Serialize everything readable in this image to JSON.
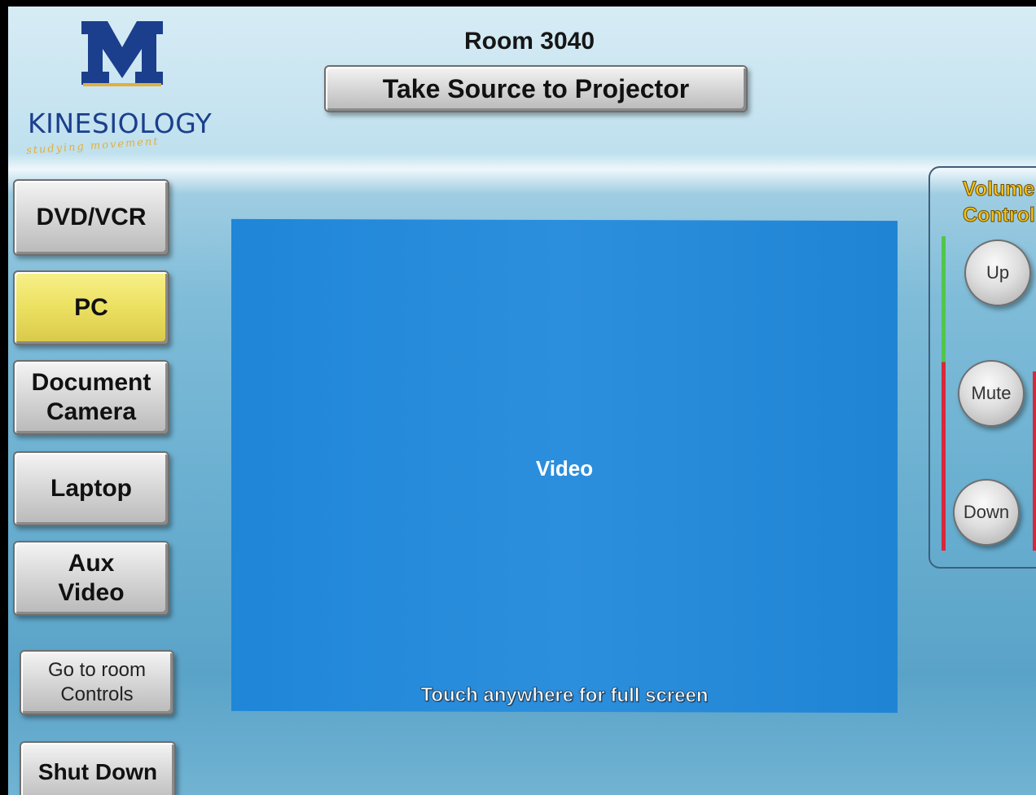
{
  "header": {
    "room_title": "Room 3040",
    "take_source_label": "Take Source to Projector"
  },
  "logo": {
    "letter": "M",
    "wordmark": "KINESIOLOGY",
    "tagline": "studying movement"
  },
  "sources": [
    {
      "label_line1": "DVD/VCR",
      "label_line2": "",
      "selected": false
    },
    {
      "label_line1": "PC",
      "label_line2": "",
      "selected": true
    },
    {
      "label_line1": "Document",
      "label_line2": "Camera",
      "selected": false
    },
    {
      "label_line1": "Laptop",
      "label_line2": "",
      "selected": false
    },
    {
      "label_line1": "Aux",
      "label_line2": "Video",
      "selected": false
    }
  ],
  "controls": {
    "room_controls_line1": "Go to room",
    "room_controls_line2": "Controls",
    "shut_down_label": "Shut Down"
  },
  "video": {
    "label": "Video",
    "hint": "Touch anywhere for full screen"
  },
  "volume": {
    "title_line1": "Volume",
    "title_line2": "Control",
    "up_label": "Up",
    "mute_label": "Mute",
    "down_label": "Down",
    "level_fraction": 0.6
  },
  "colors": {
    "selected_source": "#ece060",
    "video_panel": "#2a8cdc",
    "volume_title": "#f3c21d",
    "level_green": "#52c64a",
    "level_red": "#d8283a",
    "logo_blue": "#1b3f8c",
    "logo_gold": "#e0b040"
  }
}
